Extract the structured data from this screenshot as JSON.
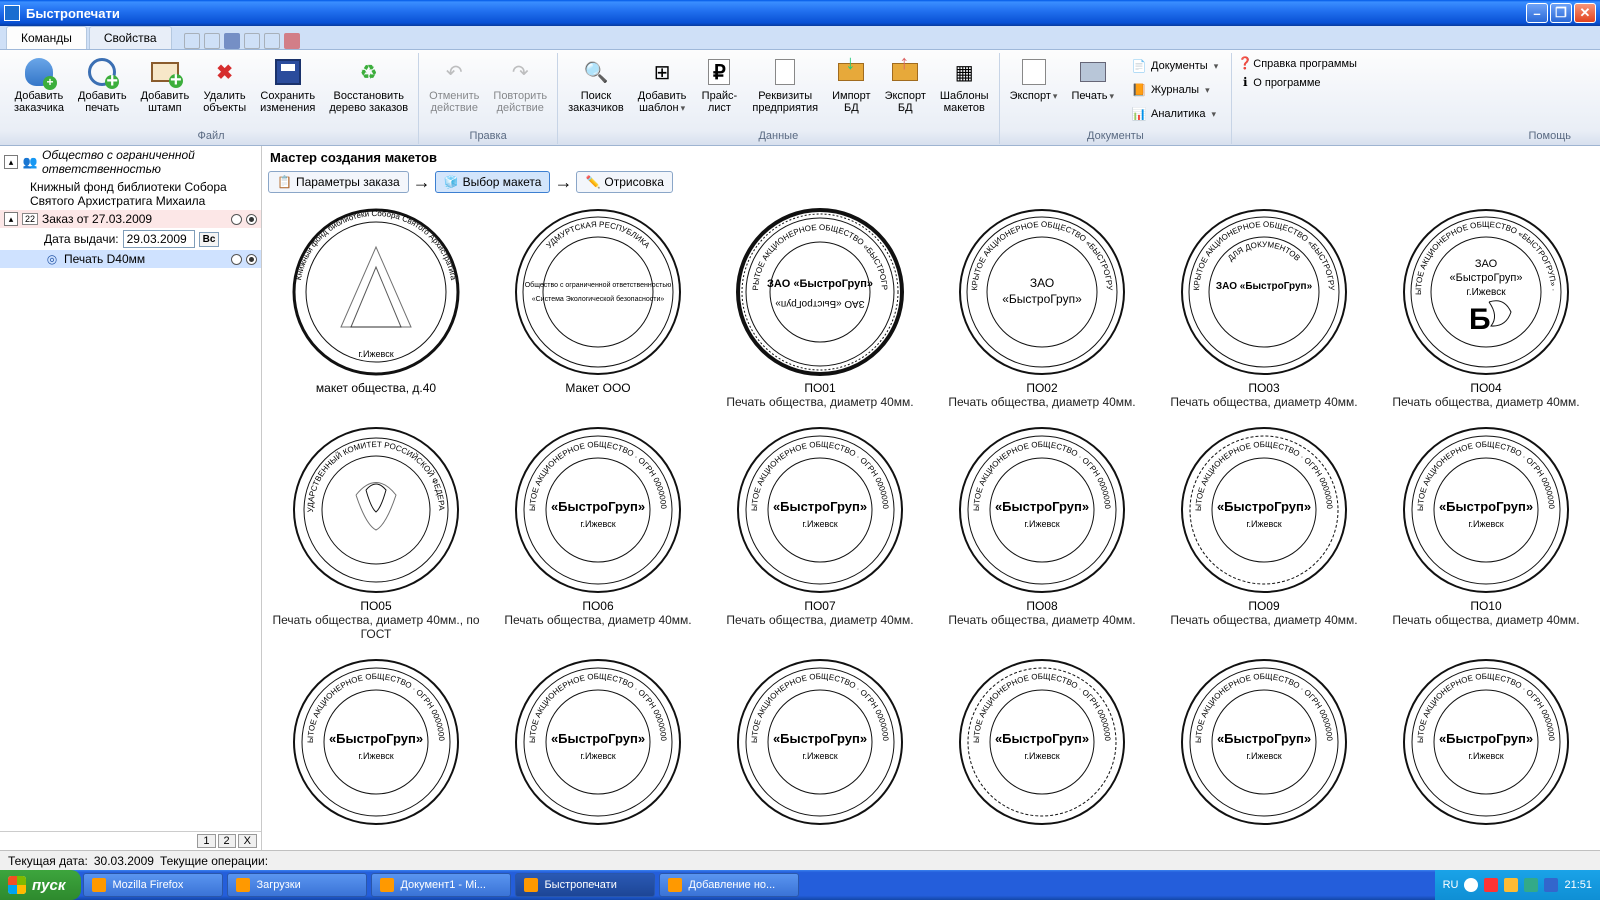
{
  "window": {
    "title": "Быстропечати"
  },
  "tabs": {
    "commands": "Команды",
    "properties": "Свойства"
  },
  "ribbon": {
    "groups": {
      "file": {
        "label": "Файл",
        "add_customer": "Добавить\nзаказчика",
        "add_seal": "Добавить\nпечать",
        "add_stamp": "Добавить\nштамп",
        "delete_objects": "Удалить\nобъекты",
        "save_changes": "Сохранить\nизменения",
        "restore_tree": "Восстановить\nдерево заказов"
      },
      "edit": {
        "label": "Правка",
        "undo": "Отменить\nдействие",
        "redo": "Повторить\nдействие"
      },
      "data": {
        "label": "Данные",
        "search_customers": "Поиск\nзаказчиков",
        "add_template": "Добавить\nшаблон",
        "price_list": "Прайс-\nлист",
        "company_details": "Реквизиты\nпредприятия",
        "import_db": "Импорт\nБД",
        "export_db": "Экспорт\nБД",
        "layout_templates": "Шаблоны\nмакетов"
      },
      "documents": {
        "label": "Документы",
        "export": "Экспорт",
        "print": "Печать",
        "documents": "Документы",
        "journals": "Журналы",
        "analytics": "Аналитика"
      },
      "help": {
        "label": "Помощь",
        "help_program": "Справка программы",
        "about": "О программе"
      }
    }
  },
  "tree": {
    "org_line1": "Общество с ограниченной",
    "org_line2": "ответственностью",
    "org_desc1": "Книжный фонд библиотеки Собора",
    "org_desc2": "Святого Архистратига Михаила",
    "order": "Заказ от 27.03.2009",
    "issue_date_label": "Дата выдачи:",
    "issue_date": "29.03.2009",
    "bc": "Bc",
    "print_item": "Печать D40мм",
    "tabs": {
      "t1": "1",
      "t2": "2",
      "tx": "X"
    }
  },
  "master": {
    "title": "Мастер создания макетов",
    "step1": "Параметры заказа",
    "step2": "Выбор макета",
    "step3": "Отрисовка"
  },
  "stamps": [
    {
      "code": "макет общества, д.40",
      "sub": ""
    },
    {
      "code": "Макет ООО",
      "sub": ""
    },
    {
      "code": "ПО01",
      "sub": "Печать общества, диаметр 40мм."
    },
    {
      "code": "ПО02",
      "sub": "Печать общества, диаметр 40мм."
    },
    {
      "code": "ПО03",
      "sub": "Печать общества, диаметр 40мм."
    },
    {
      "code": "ПО04",
      "sub": "Печать общества, диаметр 40мм."
    },
    {
      "code": "ПО05",
      "sub": "Печать общества, диаметр 40мм., по ГОСТ"
    },
    {
      "code": "ПО06",
      "sub": "Печать общества, диаметр 40мм."
    },
    {
      "code": "ПО07",
      "sub": "Печать общества, диаметр 40мм."
    },
    {
      "code": "ПО08",
      "sub": "Печать общества, диаметр 40мм."
    },
    {
      "code": "ПО09",
      "sub": "Печать общества, диаметр 40мм."
    },
    {
      "code": "ПО10",
      "sub": "Печать общества, диаметр 40мм."
    }
  ],
  "stamp_texts": {
    "zao": "ЗАО",
    "bystrogroup": "«БыстроГруп»",
    "izhevsk": "г.Ижевск",
    "b": "Б",
    "ooo_l1": "Общество с ограниченной ответственностью",
    "ooo_l2": "«Система Экологической безопасности»",
    "zao_bg": "ЗАО «БыстроГруп»",
    "for_docs": "ДЛЯ ДОКУМЕНТОВ"
  },
  "status": {
    "current_date_label": "Текущая дата:",
    "current_date": "30.03.2009",
    "current_ops": "Текущие операции:"
  },
  "taskbar": {
    "start": "пуск",
    "tasks": [
      "Mozilla Firefox",
      "Загрузки",
      "Документ1 - Mi...",
      "Быстропечати",
      "Добавление но..."
    ],
    "lang": "RU",
    "clock": "21:51"
  }
}
